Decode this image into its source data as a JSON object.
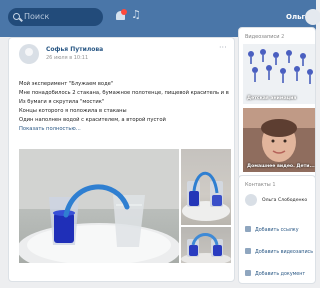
{
  "header": {
    "search_placeholder": "Поиск",
    "search_icon": "search-icon",
    "notifications_icon": "bell-icon",
    "music_icon": "music-icon",
    "music_glyph": "♫",
    "user_name": "Ольга",
    "brand_color": "#4a76a8"
  },
  "post": {
    "author": "Софья Путилова",
    "date": "26 июля в 10:11",
    "more_glyph": "···",
    "lines": [
      "Мой эксперимент \"Блужаем воде\"",
      "Мне понадобилось 2 стакана, бумажное полотенце, пищевой краситель и вода",
      "Из бумаги я скрутила \"мостик\"",
      "Концы которого я положила в стаканы",
      "Один наполнен водой с красителем, а второй пустой"
    ],
    "show_more": "Показать полностью...",
    "photos": [
      "photo-main",
      "photo-side-top",
      "photo-side-bottom"
    ]
  },
  "sidebar": {
    "videos_title": "Видеозаписи",
    "videos_count": "2",
    "videos": [
      {
        "caption": "Детская анимация"
      },
      {
        "caption": "Домашнее видео. Дети..."
      }
    ],
    "contacts_title": "Контакты",
    "contacts_count": "1",
    "contact_name": "Ольга Слободенко",
    "actions": [
      {
        "label": "Добавить ссылку",
        "icon": "link-icon"
      },
      {
        "label": "Добавить видеозапись",
        "icon": "video-icon"
      },
      {
        "label": "Добавить документ",
        "icon": "document-icon"
      }
    ]
  }
}
